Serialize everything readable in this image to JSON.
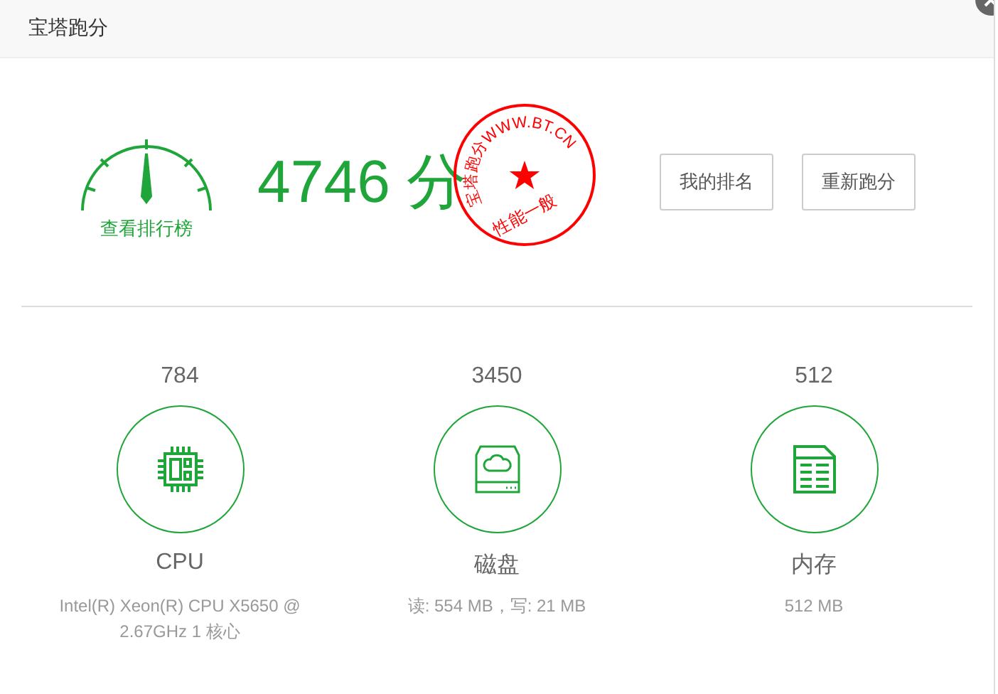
{
  "window": {
    "title": "宝塔跑分"
  },
  "summary": {
    "gauge_label": "查看排行榜",
    "score": "4746 分",
    "stamp": {
      "ring_text": "宝塔跑分WWW.BT.CN",
      "rating": "性能一般"
    }
  },
  "buttons": [
    "我的排名",
    "重新跑分"
  ],
  "metrics": [
    {
      "kind": "cpu",
      "score": "784",
      "name": "CPU",
      "detail": "Intel(R) Xeon(R) CPU X5650 @ 2.67GHz 1 核心"
    },
    {
      "kind": "disk",
      "score": "3450",
      "name": "磁盘",
      "detail": "读: 554 MB，写: 21 MB"
    },
    {
      "kind": "memory",
      "score": "512",
      "name": "内存",
      "detail": "512 MB"
    }
  ]
}
